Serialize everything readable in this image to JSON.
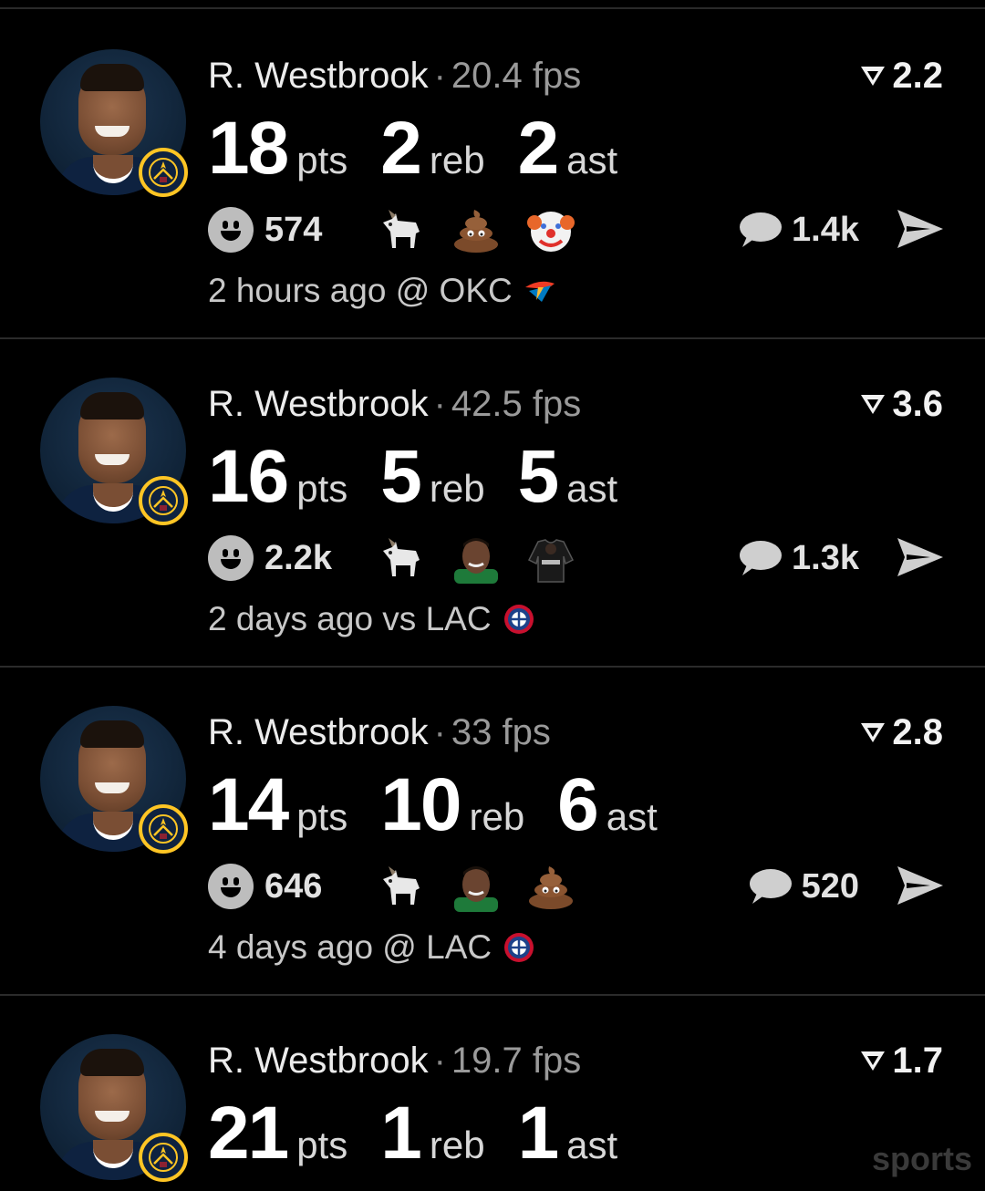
{
  "feed": {
    "cards": [
      {
        "player": "R. Westbrook",
        "fps": "20.4 fps",
        "rating": "2.2",
        "stats": [
          {
            "value": "18",
            "unit": "pts"
          },
          {
            "value": "2",
            "unit": "reb"
          },
          {
            "value": "2",
            "unit": "ast"
          }
        ],
        "reaction_count": "574",
        "reaction_emojis": [
          "goat-emoji",
          "poop-emoji",
          "clown-emoji"
        ],
        "comment_count": "1.4k",
        "meta": "2 hours ago @ OKC",
        "opponent_logo": "okc-thunder-logo"
      },
      {
        "player": "R. Westbrook",
        "fps": "42.5 fps",
        "rating": "3.6",
        "stats": [
          {
            "value": "16",
            "unit": "pts"
          },
          {
            "value": "5",
            "unit": "reb"
          },
          {
            "value": "5",
            "unit": "ast"
          }
        ],
        "reaction_count": "2.2k",
        "reaction_emojis": [
          "goat-emoji",
          "player-face-emoji",
          "nets-jersey-emoji"
        ],
        "comment_count": "1.3k",
        "meta": "2 days ago vs LAC",
        "opponent_logo": "la-clippers-logo"
      },
      {
        "player": "R. Westbrook",
        "fps": "33 fps",
        "rating": "2.8",
        "stats": [
          {
            "value": "14",
            "unit": "pts"
          },
          {
            "value": "10",
            "unit": "reb"
          },
          {
            "value": "6",
            "unit": "ast"
          }
        ],
        "reaction_count": "646",
        "reaction_emojis": [
          "goat-emoji",
          "player-face-emoji",
          "poop-emoji"
        ],
        "comment_count": "520",
        "meta": "4 days ago @ LAC",
        "opponent_logo": "la-clippers-logo"
      },
      {
        "player": "R. Westbrook",
        "fps": "19.7 fps",
        "rating": "1.7",
        "stats": [
          {
            "value": "21",
            "unit": "pts"
          },
          {
            "value": "1",
            "unit": "reb"
          },
          {
            "value": "1",
            "unit": "ast"
          }
        ],
        "reaction_count": "",
        "reaction_emojis": [],
        "comment_count": "",
        "meta": "",
        "opponent_logo": ""
      }
    ]
  },
  "watermark": "sports",
  "colors": {
    "background": "#000000",
    "divider": "#2b2b2b",
    "nuggets_gold": "#fec524",
    "nuggets_navy": "#0e2240"
  }
}
